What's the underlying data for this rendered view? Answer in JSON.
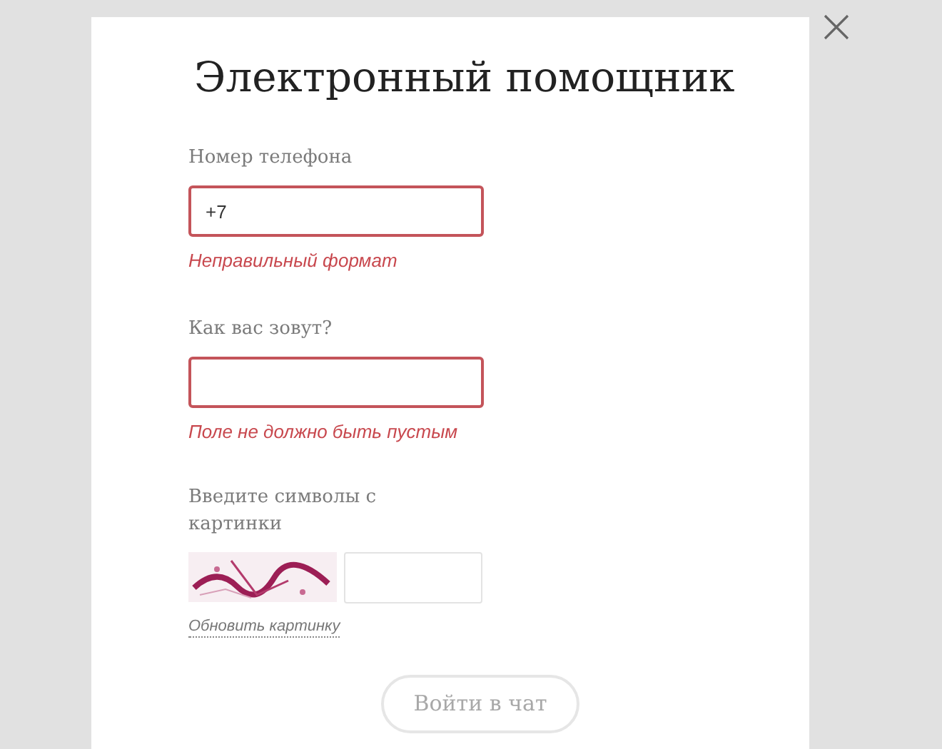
{
  "dialog": {
    "title": "Электронный помощник"
  },
  "fields": [
    {
      "label": "Номер телефона",
      "value": "+7",
      "invalid": true,
      "error": "Неправильный формат"
    },
    {
      "label": "Как вас зовут?",
      "invalid": true,
      "error": "Поле не должно быть пустым"
    }
  ],
  "captcha": {
    "label": "Введите символы с картинки",
    "refresh_link": "Обновить картинку"
  },
  "submit": {
    "label": "Войти в чат",
    "disabled": true
  }
}
